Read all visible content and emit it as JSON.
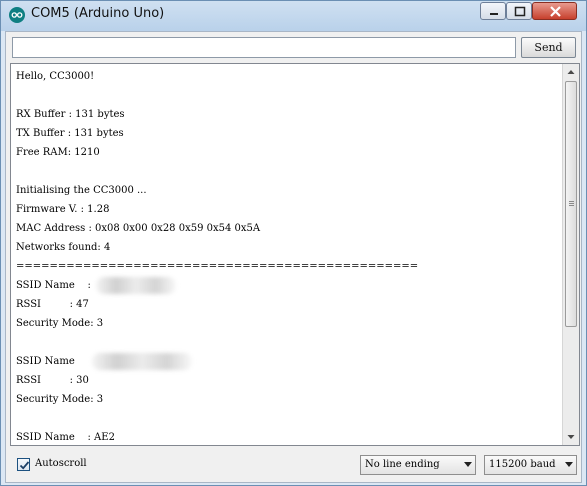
{
  "window": {
    "title": "COM5 (Arduino Uno)",
    "icon": "arduino-logo-icon"
  },
  "send": {
    "input_value": "",
    "button_label": "Send"
  },
  "serial_lines": [
    "Hello, CC3000!",
    "",
    "RX Buffer : 131 bytes",
    "TX Buffer : 131 bytes",
    "Free RAM: 1210",
    "",
    "Initialising the CC3000 ...",
    "Firmware V. : 1.28",
    "MAC Address : 0x08 0x00 0x28 0x59 0x54 0x5A",
    "Networks found: 4",
    "================================================",
    "SSID Name    : ",
    "RSSI         : 47",
    "Security Mode: 3",
    "",
    "SSID Name    ",
    "RSSI         : 30",
    "Security Mode: 3",
    "",
    "SSID Name    : AE2"
  ],
  "footer": {
    "autoscroll_label": "Autoscroll",
    "autoscroll_checked": true,
    "line_ending": "No line ending",
    "baud_rate": "115200 baud"
  },
  "colors": {
    "title_bar": "#b9d1ea",
    "close_button": "#c7402d",
    "arduino_teal": "#0f7f82"
  }
}
